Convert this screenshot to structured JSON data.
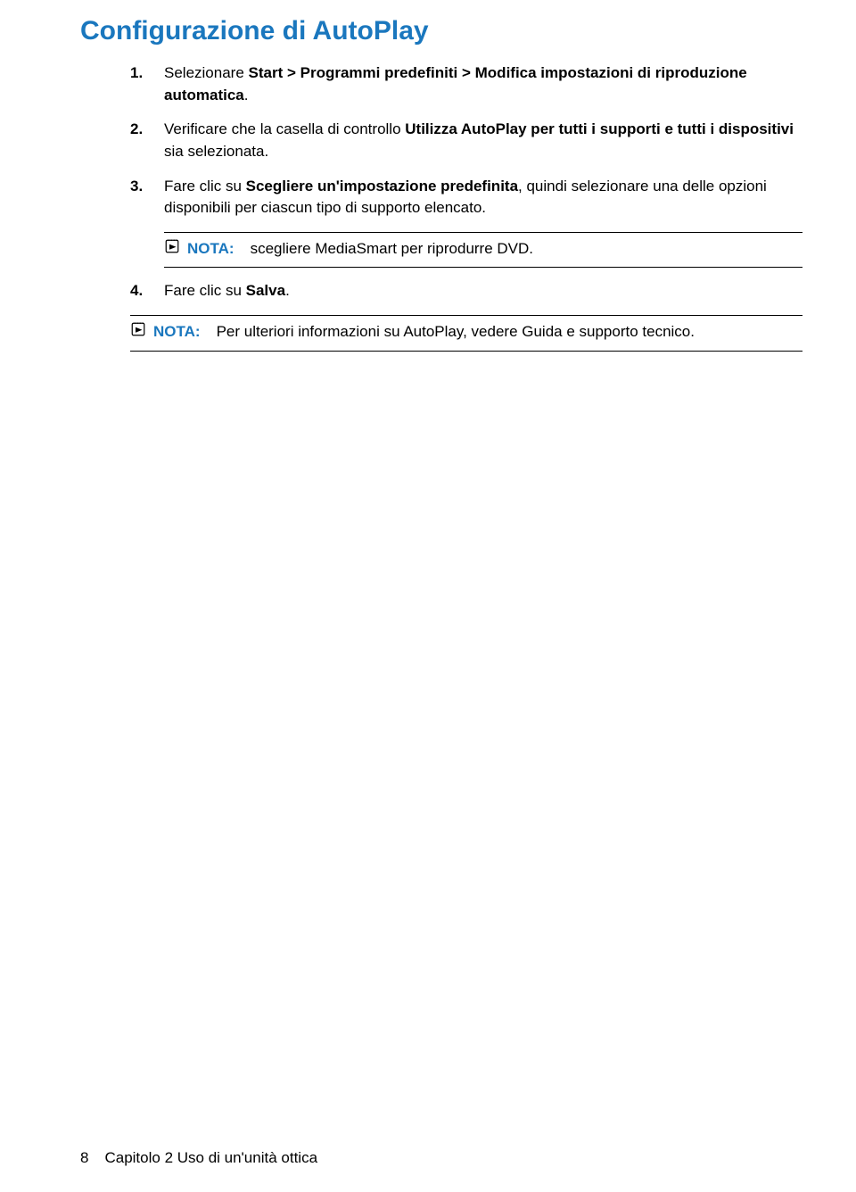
{
  "title": "Configurazione di AutoPlay",
  "steps": [
    {
      "num": "1.",
      "html": "Selezionare <strong>Start > Programmi predefiniti > Modifica impostazioni di riproduzione automatica</strong>."
    },
    {
      "num": "2.",
      "html": "Verificare che la casella di controllo <strong>Utilizza AutoPlay per tutti i supporti e tutti i dispositivi</strong> sia selezionata."
    },
    {
      "num": "3.",
      "html": "Fare clic su <strong>Scegliere un'impostazione predefinita</strong>, quindi selezionare una delle opzioni disponibili per ciascun tipo di supporto elencato."
    }
  ],
  "note1": {
    "label": "NOTA:",
    "text": "scegliere MediaSmart per riprodurre DVD."
  },
  "step4": {
    "num": "4.",
    "html": "Fare clic su <strong>Salva</strong>."
  },
  "note2": {
    "label": "NOTA:",
    "text": "Per ulteriori informazioni su AutoPlay, vedere Guida e supporto tecnico."
  },
  "footer": {
    "page": "8",
    "text": "Capitolo 2   Uso di un'unità ottica"
  }
}
